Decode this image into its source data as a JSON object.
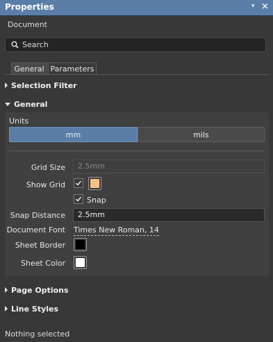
{
  "panel": {
    "title": "Properties",
    "pin_glyph": "▾",
    "close_glyph": "×"
  },
  "header": {
    "object_type": "Document"
  },
  "search": {
    "placeholder": "Search",
    "icon": "search-icon"
  },
  "tabs": [
    {
      "label": "General",
      "active": true
    },
    {
      "label": "Parameters",
      "active": false
    }
  ],
  "sections": {
    "selection_filter": "Selection Filter",
    "general": "General",
    "page_options": "Page Options",
    "line_styles": "Line Styles"
  },
  "general": {
    "units_label": "Units",
    "units_options": [
      "mm",
      "mils"
    ],
    "units_selected": "mm",
    "grid_size_label": "Grid Size",
    "grid_size_value": "2.5mm",
    "show_grid_label": "Show Grid",
    "show_grid_checked": true,
    "grid_color": "#f7c08a",
    "snap_label": "Snap",
    "snap_checked": true,
    "snap_distance_label": "Snap Distance",
    "snap_distance_value": "2.5mm",
    "document_font_label": "Document Font",
    "document_font_value": "Times New Roman, 14",
    "sheet_border_label": "Sheet Border",
    "sheet_border_color": "#000000",
    "sheet_color_label": "Sheet Color",
    "sheet_color": "#ffffff"
  },
  "status": {
    "text": "Nothing selected"
  },
  "colors": {
    "accent": "#5a7ea8",
    "background": "#383838"
  }
}
